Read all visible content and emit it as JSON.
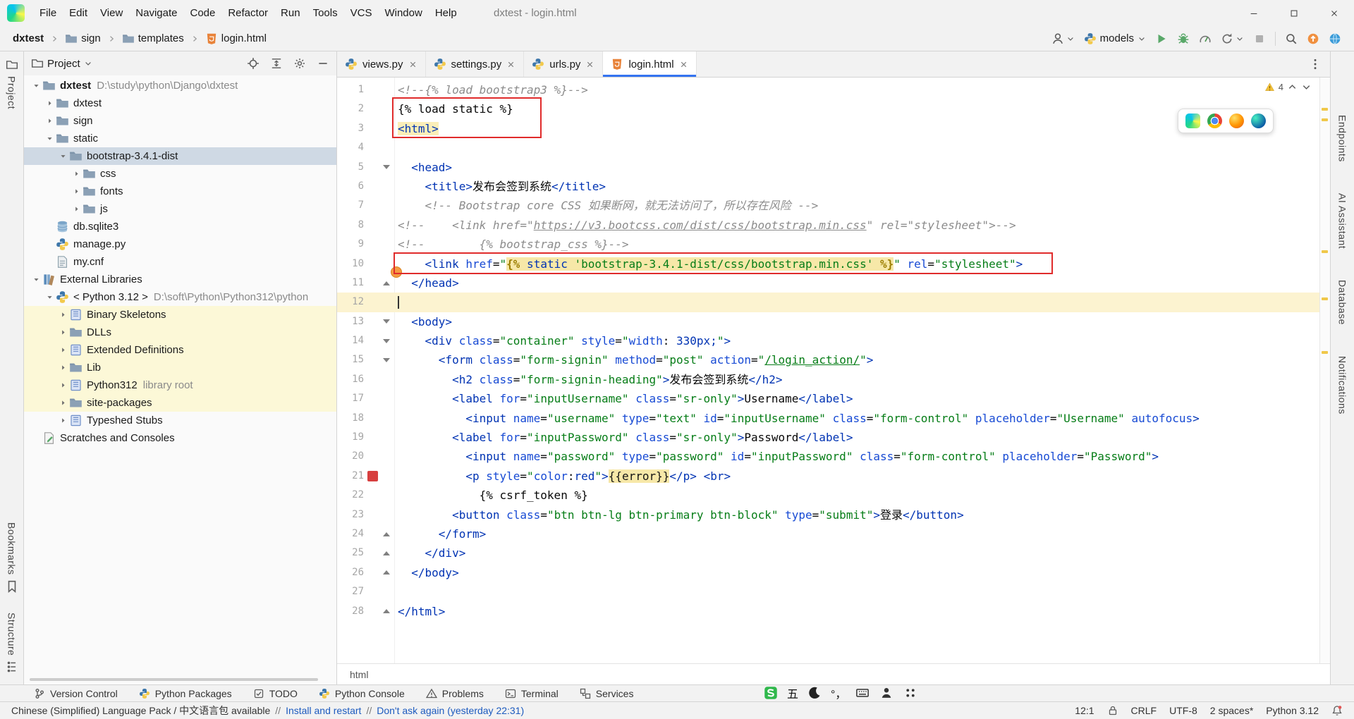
{
  "window": {
    "title": "dxtest - login.html"
  },
  "menu_items": [
    "File",
    "Edit",
    "View",
    "Navigate",
    "Code",
    "Refactor",
    "Run",
    "Tools",
    "VCS",
    "Window",
    "Help"
  ],
  "breadcrumbs": [
    {
      "label": "dxtest",
      "icon": "",
      "bold": true
    },
    {
      "label": "sign",
      "icon": "folder"
    },
    {
      "label": "templates",
      "icon": "folder"
    },
    {
      "label": "login.html",
      "icon": "html-file"
    }
  ],
  "run_widget": {
    "config_name": "models"
  },
  "project_panel": {
    "title": "Project",
    "tree": [
      {
        "level": 0,
        "chevron": "expanded",
        "icon": "folder",
        "label": "dxtest",
        "hint": "D:\\study\\python\\Django\\dxtest",
        "bold": true
      },
      {
        "level": 1,
        "chevron": "collapsed",
        "icon": "folder",
        "label": "dxtest"
      },
      {
        "level": 1,
        "chevron": "collapsed",
        "icon": "folder",
        "label": "sign"
      },
      {
        "level": 1,
        "chevron": "expanded",
        "icon": "folder",
        "label": "static"
      },
      {
        "level": 2,
        "chevron": "expanded",
        "icon": "folder",
        "label": "bootstrap-3.4.1-dist",
        "selected": true
      },
      {
        "level": 3,
        "chevron": "collapsed",
        "icon": "folder",
        "label": "css"
      },
      {
        "level": 3,
        "chevron": "collapsed",
        "icon": "folder",
        "label": "fonts"
      },
      {
        "level": 3,
        "chevron": "collapsed",
        "icon": "folder",
        "label": "js"
      },
      {
        "level": 1,
        "chevron": null,
        "icon": "database",
        "label": "db.sqlite3"
      },
      {
        "level": 1,
        "chevron": null,
        "icon": "python-file",
        "label": "manage.py"
      },
      {
        "level": 1,
        "chevron": null,
        "icon": "config-file",
        "label": "my.cnf"
      },
      {
        "level": 0,
        "chevron": "expanded",
        "icon": "ext-lib",
        "label": "External Libraries"
      },
      {
        "level": 1,
        "chevron": "expanded",
        "icon": "python",
        "label": "< Python 3.12 >",
        "hint": "D:\\soft\\Python\\Python312\\python"
      },
      {
        "level": 2,
        "chevron": "collapsed",
        "icon": "library",
        "label": "Binary Skeletons",
        "highlighted": true
      },
      {
        "level": 2,
        "chevron": "collapsed",
        "icon": "folder",
        "label": "DLLs",
        "highlighted": true
      },
      {
        "level": 2,
        "chevron": "collapsed",
        "icon": "library",
        "label": "Extended Definitions",
        "highlighted": true
      },
      {
        "level": 2,
        "chevron": "collapsed",
        "icon": "folder",
        "label": "Lib",
        "highlighted": true
      },
      {
        "level": 2,
        "chevron": "collapsed",
        "icon": "library",
        "label": "Python312",
        "hint": "library root",
        "highlighted": true
      },
      {
        "level": 2,
        "chevron": "collapsed",
        "icon": "folder",
        "label": "site-packages",
        "highlighted": true
      },
      {
        "level": 2,
        "chevron": "collapsed",
        "icon": "library",
        "label": "Typeshed Stubs"
      },
      {
        "level": 0,
        "chevron": null,
        "icon": "scratches",
        "label": "Scratches and Consoles"
      }
    ]
  },
  "tabs": [
    {
      "label": "views.py",
      "icon": "python-file"
    },
    {
      "label": "settings.py",
      "icon": "python-file"
    },
    {
      "label": "urls.py",
      "icon": "python-file"
    },
    {
      "label": "login.html",
      "icon": "html-file",
      "active": true
    }
  ],
  "inspection": {
    "warning_count": "4"
  },
  "right_stripe": [
    "Endpoints",
    "AI Assistant",
    "Database",
    "Notifications"
  ],
  "left_stripe": {
    "top": "Project",
    "bottom": [
      "Bookmarks",
      "Structure"
    ]
  },
  "editor": {
    "breadcrumb": "html",
    "lines": [
      {
        "t": [
          [
            "<!--{% load bootstrap3 %}-->",
            "cm"
          ]
        ]
      },
      {
        "t": [
          [
            "{% load static %}",
            ""
          ]
        ]
      },
      {
        "t": [
          [
            "<html>",
            "hl"
          ]
        ]
      },
      {
        "t": []
      },
      {
        "t": [
          [
            "  ",
            ""
          ],
          [
            "<head>",
            "tag"
          ]
        ],
        "fold": "down"
      },
      {
        "t": [
          [
            "    ",
            ""
          ],
          [
            "<title>",
            "tag"
          ],
          [
            "发布会签到系统",
            ""
          ],
          [
            "</title>",
            "tag"
          ]
        ]
      },
      {
        "t": [
          [
            "    ",
            ""
          ],
          [
            "<!-- Bootstrap core CSS 如果断网，就无法访问了，所以存在风险 -->",
            "cm"
          ]
        ]
      },
      {
        "t": [
          [
            "<!--    <link href=\"",
            "cm"
          ],
          [
            "https://v3.bootcss.com/dist/css/bootstrap.min.css",
            "cm lnk"
          ],
          [
            "\" rel=\"stylesheet\">-->",
            "cm"
          ]
        ]
      },
      {
        "t": [
          [
            "<!--        {% bootstrap_css %}-->",
            "cm"
          ]
        ]
      },
      {
        "t": [
          [
            "    ",
            ""
          ],
          [
            "<link",
            "tag"
          ],
          [
            " ",
            ""
          ],
          [
            "href",
            "attr"
          ],
          [
            "=",
            ""
          ],
          [
            "\"",
            "str"
          ],
          [
            "{%",
            "tplb"
          ],
          [
            " static ",
            "tplk"
          ],
          [
            "'bootstrap-3.4.1-dist/css/bootstrap.min.css'",
            "tpls"
          ],
          [
            " ",
            "tplk"
          ],
          [
            "%}",
            "tplb"
          ],
          [
            "\"",
            "str"
          ],
          [
            " ",
            ""
          ],
          [
            "rel",
            "attr"
          ],
          [
            "=",
            ""
          ],
          [
            "\"stylesheet\"",
            "str"
          ],
          [
            ">",
            "tag"
          ]
        ]
      },
      {
        "t": [
          [
            "  ",
            ""
          ],
          [
            "</head>",
            "tag"
          ]
        ],
        "fold": "up"
      },
      {
        "t": [],
        "caret": true
      },
      {
        "t": [
          [
            "  ",
            ""
          ],
          [
            "<body>",
            "tag"
          ]
        ],
        "fold": "down"
      },
      {
        "t": [
          [
            "    ",
            ""
          ],
          [
            "<div",
            "tag"
          ],
          [
            " ",
            ""
          ],
          [
            "class",
            "attr"
          ],
          [
            "=",
            ""
          ],
          [
            "\"container\"",
            "str"
          ],
          [
            " ",
            ""
          ],
          [
            "style",
            "attr"
          ],
          [
            "=",
            ""
          ],
          [
            "\"",
            "str"
          ],
          [
            "width",
            "cssp"
          ],
          [
            ": ",
            ""
          ],
          [
            "330px;",
            "cssv"
          ],
          [
            "\"",
            "str"
          ],
          [
            ">",
            "tag"
          ]
        ],
        "fold": "down"
      },
      {
        "t": [
          [
            "      ",
            ""
          ],
          [
            "<form",
            "tag"
          ],
          [
            " ",
            ""
          ],
          [
            "class",
            "attr"
          ],
          [
            "=",
            ""
          ],
          [
            "\"form-signin\"",
            "str"
          ],
          [
            " ",
            ""
          ],
          [
            "method",
            "attr"
          ],
          [
            "=",
            ""
          ],
          [
            "\"post\"",
            "str"
          ],
          [
            " ",
            ""
          ],
          [
            "action",
            "attr"
          ],
          [
            "=",
            ""
          ],
          [
            "\"",
            "str"
          ],
          [
            "/login_action/",
            "str lnk"
          ],
          [
            "\"",
            "str"
          ],
          [
            ">",
            "tag"
          ]
        ],
        "fold": "down"
      },
      {
        "t": [
          [
            "        ",
            ""
          ],
          [
            "<h2",
            "tag"
          ],
          [
            " ",
            ""
          ],
          [
            "class",
            "attr"
          ],
          [
            "=",
            ""
          ],
          [
            "\"form-signin-heading\"",
            "str"
          ],
          [
            ">",
            "tag"
          ],
          [
            "发布会签到系统",
            ""
          ],
          [
            "</h2>",
            "tag"
          ]
        ]
      },
      {
        "t": [
          [
            "        ",
            ""
          ],
          [
            "<label",
            "tag"
          ],
          [
            " ",
            ""
          ],
          [
            "for",
            "attr"
          ],
          [
            "=",
            ""
          ],
          [
            "\"inputUsername\"",
            "str"
          ],
          [
            " ",
            ""
          ],
          [
            "class",
            "attr"
          ],
          [
            "=",
            ""
          ],
          [
            "\"sr-only\"",
            "str"
          ],
          [
            ">",
            "tag"
          ],
          [
            "Username",
            ""
          ],
          [
            "</label>",
            "tag"
          ]
        ]
      },
      {
        "t": [
          [
            "          ",
            ""
          ],
          [
            "<input",
            "tag"
          ],
          [
            " ",
            ""
          ],
          [
            "name",
            "attr"
          ],
          [
            "=",
            ""
          ],
          [
            "\"username\"",
            "str"
          ],
          [
            " ",
            ""
          ],
          [
            "type",
            "attr"
          ],
          [
            "=",
            ""
          ],
          [
            "\"text\"",
            "str"
          ],
          [
            " ",
            ""
          ],
          [
            "id",
            "attr"
          ],
          [
            "=",
            ""
          ],
          [
            "\"inputUsername\"",
            "str"
          ],
          [
            " ",
            ""
          ],
          [
            "class",
            "attr"
          ],
          [
            "=",
            ""
          ],
          [
            "\"form-control\"",
            "str"
          ],
          [
            " ",
            ""
          ],
          [
            "placeholder",
            "attr"
          ],
          [
            "=",
            ""
          ],
          [
            "\"Username\"",
            "str"
          ],
          [
            " ",
            ""
          ],
          [
            "autofocus",
            "attr"
          ],
          [
            ">",
            "tag"
          ]
        ]
      },
      {
        "t": [
          [
            "        ",
            ""
          ],
          [
            "<label",
            "tag"
          ],
          [
            " ",
            ""
          ],
          [
            "for",
            "attr"
          ],
          [
            "=",
            ""
          ],
          [
            "\"inputPassword\"",
            "str"
          ],
          [
            " ",
            ""
          ],
          [
            "class",
            "attr"
          ],
          [
            "=",
            ""
          ],
          [
            "\"sr-only\"",
            "str"
          ],
          [
            ">",
            "tag"
          ],
          [
            "Password",
            ""
          ],
          [
            "</label>",
            "tag"
          ]
        ]
      },
      {
        "t": [
          [
            "          ",
            ""
          ],
          [
            "<input",
            "tag"
          ],
          [
            " ",
            ""
          ],
          [
            "name",
            "attr"
          ],
          [
            "=",
            ""
          ],
          [
            "\"password\"",
            "str"
          ],
          [
            " ",
            ""
          ],
          [
            "type",
            "attr"
          ],
          [
            "=",
            ""
          ],
          [
            "\"password\"",
            "str"
          ],
          [
            " ",
            ""
          ],
          [
            "id",
            "attr"
          ],
          [
            "=",
            ""
          ],
          [
            "\"inputPassword\"",
            "str"
          ],
          [
            " ",
            ""
          ],
          [
            "class",
            "attr"
          ],
          [
            "=",
            ""
          ],
          [
            "\"form-control\"",
            "str"
          ],
          [
            " ",
            ""
          ],
          [
            "placeholder",
            "attr"
          ],
          [
            "=",
            ""
          ],
          [
            "\"Password\"",
            "str"
          ],
          [
            ">",
            "tag"
          ]
        ]
      },
      {
        "t": [
          [
            "          ",
            ""
          ],
          [
            "<p",
            "tag"
          ],
          [
            " ",
            ""
          ],
          [
            "style",
            "attr"
          ],
          [
            "=",
            ""
          ],
          [
            "\"",
            "str"
          ],
          [
            "color",
            "cssp"
          ],
          [
            ":",
            ""
          ],
          [
            "red",
            "cssv"
          ],
          [
            "\"",
            "str"
          ],
          [
            ">",
            "tag"
          ],
          [
            "{{error}}",
            "tpl"
          ],
          [
            "</p>",
            "tag"
          ],
          [
            " ",
            ""
          ],
          [
            "<br>",
            "tag"
          ]
        ],
        "bp": true
      },
      {
        "t": [
          [
            "            {% csrf_token %}",
            ""
          ]
        ]
      },
      {
        "t": [
          [
            "        ",
            ""
          ],
          [
            "<button",
            "tag"
          ],
          [
            " ",
            ""
          ],
          [
            "class",
            "attr"
          ],
          [
            "=",
            ""
          ],
          [
            "\"btn btn-lg btn-primary btn-block\"",
            "str"
          ],
          [
            " ",
            ""
          ],
          [
            "type",
            "attr"
          ],
          [
            "=",
            ""
          ],
          [
            "\"submit\"",
            "str"
          ],
          [
            ">",
            "tag"
          ],
          [
            "登录",
            ""
          ],
          [
            "</button>",
            "tag"
          ]
        ]
      },
      {
        "t": [
          [
            "      ",
            ""
          ],
          [
            "</form>",
            "tag"
          ]
        ],
        "fold": "up"
      },
      {
        "t": [
          [
            "    ",
            ""
          ],
          [
            "</div>",
            "tag"
          ]
        ],
        "fold": "up"
      },
      {
        "t": [
          [
            "  ",
            ""
          ],
          [
            "</body>",
            "tag"
          ]
        ],
        "fold": "up"
      },
      {
        "t": []
      },
      {
        "t": [
          [
            "</html>",
            "tag"
          ]
        ],
        "fold": "up"
      }
    ]
  },
  "tool_buttons": [
    {
      "label": "Version Control",
      "icon": "branch"
    },
    {
      "label": "Python Packages",
      "icon": "python"
    },
    {
      "label": "TODO",
      "icon": "todo"
    },
    {
      "label": "Python Console",
      "icon": "python"
    },
    {
      "label": "Problems",
      "icon": "problems"
    },
    {
      "label": "Terminal",
      "icon": "terminal"
    },
    {
      "label": "Services",
      "icon": "services"
    }
  ],
  "ime": [
    {
      "icon": "sogou"
    },
    {
      "icon": "wubi",
      "text": "五"
    },
    {
      "icon": "moon"
    },
    {
      "icon": "punct",
      "text": "°，"
    },
    {
      "icon": "keyboard"
    },
    {
      "icon": "voice"
    },
    {
      "icon": "grid"
    }
  ],
  "status_bar": {
    "message": [
      {
        "text": "Chinese (Simplified) Language Pack / 中文语言包 available",
        "link": false
      },
      {
        "text": "//",
        "sep": true
      },
      {
        "text": "Install and restart",
        "link": true
      },
      {
        "text": "//",
        "sep": true
      },
      {
        "text": "Don't ask again (yesterday 22:31)",
        "link": true
      }
    ],
    "caret": "12:1",
    "line_ending": "CRLF",
    "encoding": "UTF-8",
    "indent": "2 spaces*",
    "interpreter": "Python 3.12"
  },
  "accents": {
    "annotation_red": "#e02b2b",
    "breakpoint_red": "#d73f3f",
    "selection": "#cfd9e4",
    "library_highlight": "#fcf8d7",
    "caret_line": "#fcf3d0",
    "warning_yellow": "#f2c038",
    "tab_underline": "#3574f0"
  }
}
